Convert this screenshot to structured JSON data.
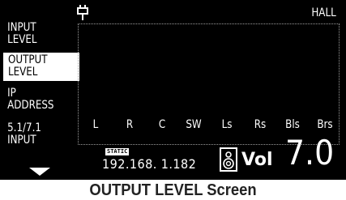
{
  "menu": {
    "items": [
      {
        "label": "INPUT\nLEVEL",
        "selected": false
      },
      {
        "label": "OUTPUT\nLEVEL",
        "selected": true
      },
      {
        "label": "IP\nADDRESS",
        "selected": false
      },
      {
        "label": "5.1/7.1\nINPUT",
        "selected": false
      }
    ],
    "scroll_icon": "triangle-down-icon"
  },
  "header": {
    "mode": "HALL",
    "input_icon": "plug-icon"
  },
  "channels": [
    "L",
    "R",
    "C",
    "SW",
    "Ls",
    "Rs",
    "Bls",
    "Brs"
  ],
  "status": {
    "ip_mode_badge": "STATIC",
    "ip_address": "192.168. 1.182",
    "speaker_icon": "speaker-icon",
    "volume_label": "Vol",
    "volume_value": "7.0"
  },
  "caption": "OUTPUT LEVEL Screen",
  "colors": {
    "screen_bg": "#000000",
    "text": "#ffffff",
    "selected_bg": "#ffffff",
    "selected_text": "#000000"
  }
}
